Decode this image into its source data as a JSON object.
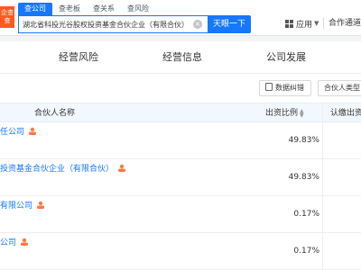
{
  "header": {
    "logo_text": "企查查",
    "search_tabs": [
      "查公司",
      "查老板",
      "查关系",
      "查风险"
    ],
    "search_value": "湖北省科投光谷股权投资基金合伙企业（有限合伙）",
    "search_button": "天眼一下",
    "apps_label": "应用",
    "partner_label": "合作通道"
  },
  "module_tabs": [
    "经营风险",
    "经营信息",
    "公司发展"
  ],
  "toolbar": {
    "data_correction": "数据纠错",
    "partner_type": "合伙人类型"
  },
  "table": {
    "columns": {
      "name": "合伙人名称",
      "ratio": "出资比例",
      "amount": "认缴出资"
    },
    "rows": [
      {
        "name": "任公司",
        "ratio": "49.83%"
      },
      {
        "name": "投资基金合伙企业（有限合伙）",
        "ratio": "49.83%"
      },
      {
        "name": "有限公司",
        "ratio": "0.17%"
      },
      {
        "name": "公司",
        "ratio": "0.17%"
      }
    ]
  },
  "colors": {
    "primary": "#1677ff",
    "logo": "#ff5a1f",
    "person_icon": "#ff7a45"
  }
}
